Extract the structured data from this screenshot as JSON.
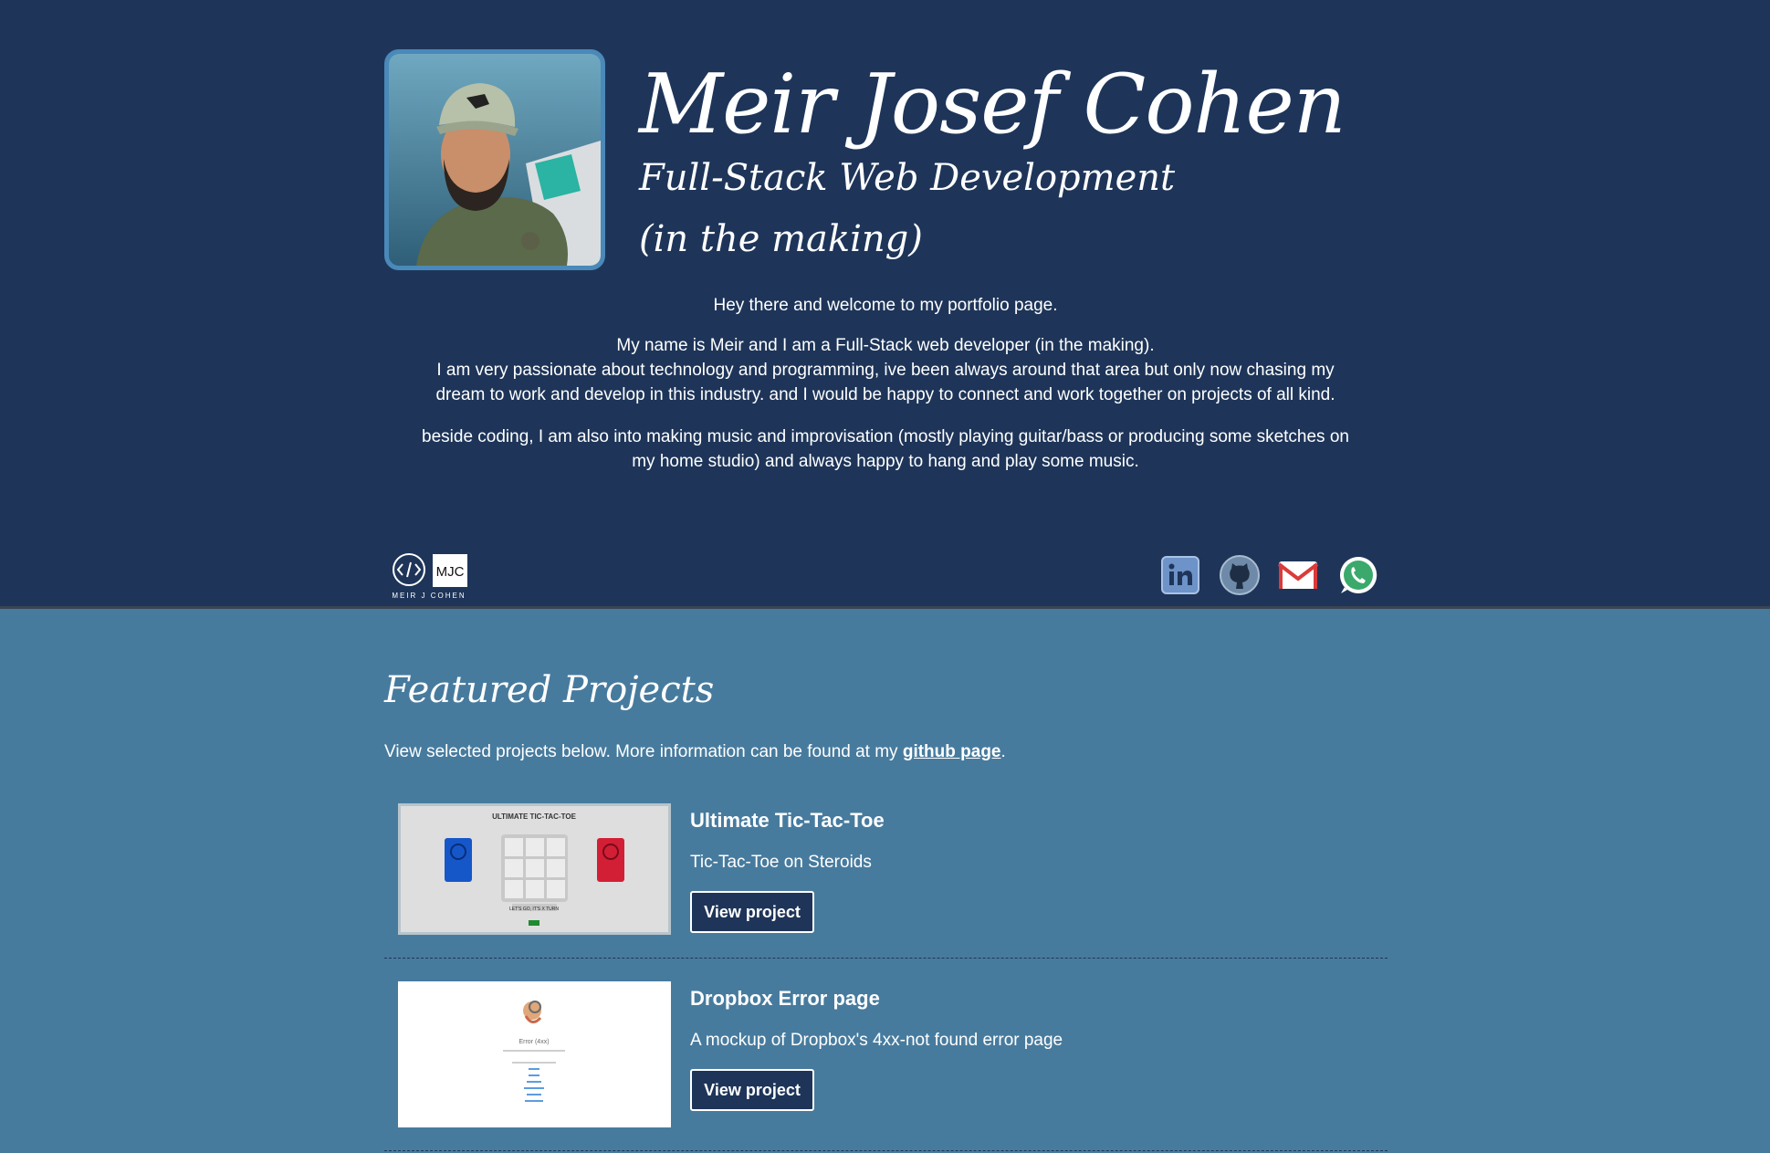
{
  "header": {
    "name": "Meir Josef Cohen",
    "subtitle_line1": "Full-Stack Web Development",
    "subtitle_line2": "(in the making)",
    "avatar_alt": "profile photo"
  },
  "intro": {
    "p1": "Hey there and welcome to my portfolio page.",
    "p2_line1": "My name is Meir and I am a Full-Stack web developer (in the making).",
    "p2_line2": "I am very passionate about technology and programming, ive been always around that area but only now chasing my",
    "p2_line3": "dream to work and develop in this industry. and I would be happy to connect and work together on projects of all kind.",
    "p3_line1": "beside coding, I am also into making music and improvisation (mostly playing guitar/bass or producing some sketches on",
    "p3_line2": "my home studio) and always happy to hang and play some music."
  },
  "logo": {
    "mark_text": "MJC",
    "caption": "MEIR J COHEN"
  },
  "social": [
    "linkedin",
    "github",
    "gmail",
    "whatsapp"
  ],
  "colors": {
    "header_bg": "#1e3559",
    "section_bg": "#477b9e",
    "accent": "#4a89b9"
  },
  "projects_section": {
    "title": "Featured Projects",
    "desc_prefix": "View selected projects below. More information can be found at my ",
    "desc_link": "github page",
    "desc_suffix": ".",
    "items": [
      {
        "title": "Ultimate Tic-Tac-Toe",
        "desc": "Tic-Tac-Toe on Steroids",
        "button": "View project",
        "thumb": {
          "heading": "ULTIMATE TIC-TAC-TOE",
          "caption": "LET'S GO, IT'S X TURN"
        }
      },
      {
        "title": "Dropbox Error page",
        "desc": "A mockup of Dropbox's 4xx-not found error page",
        "button": "View project",
        "thumb": {
          "heading": "Error (4xx)"
        }
      }
    ]
  }
}
